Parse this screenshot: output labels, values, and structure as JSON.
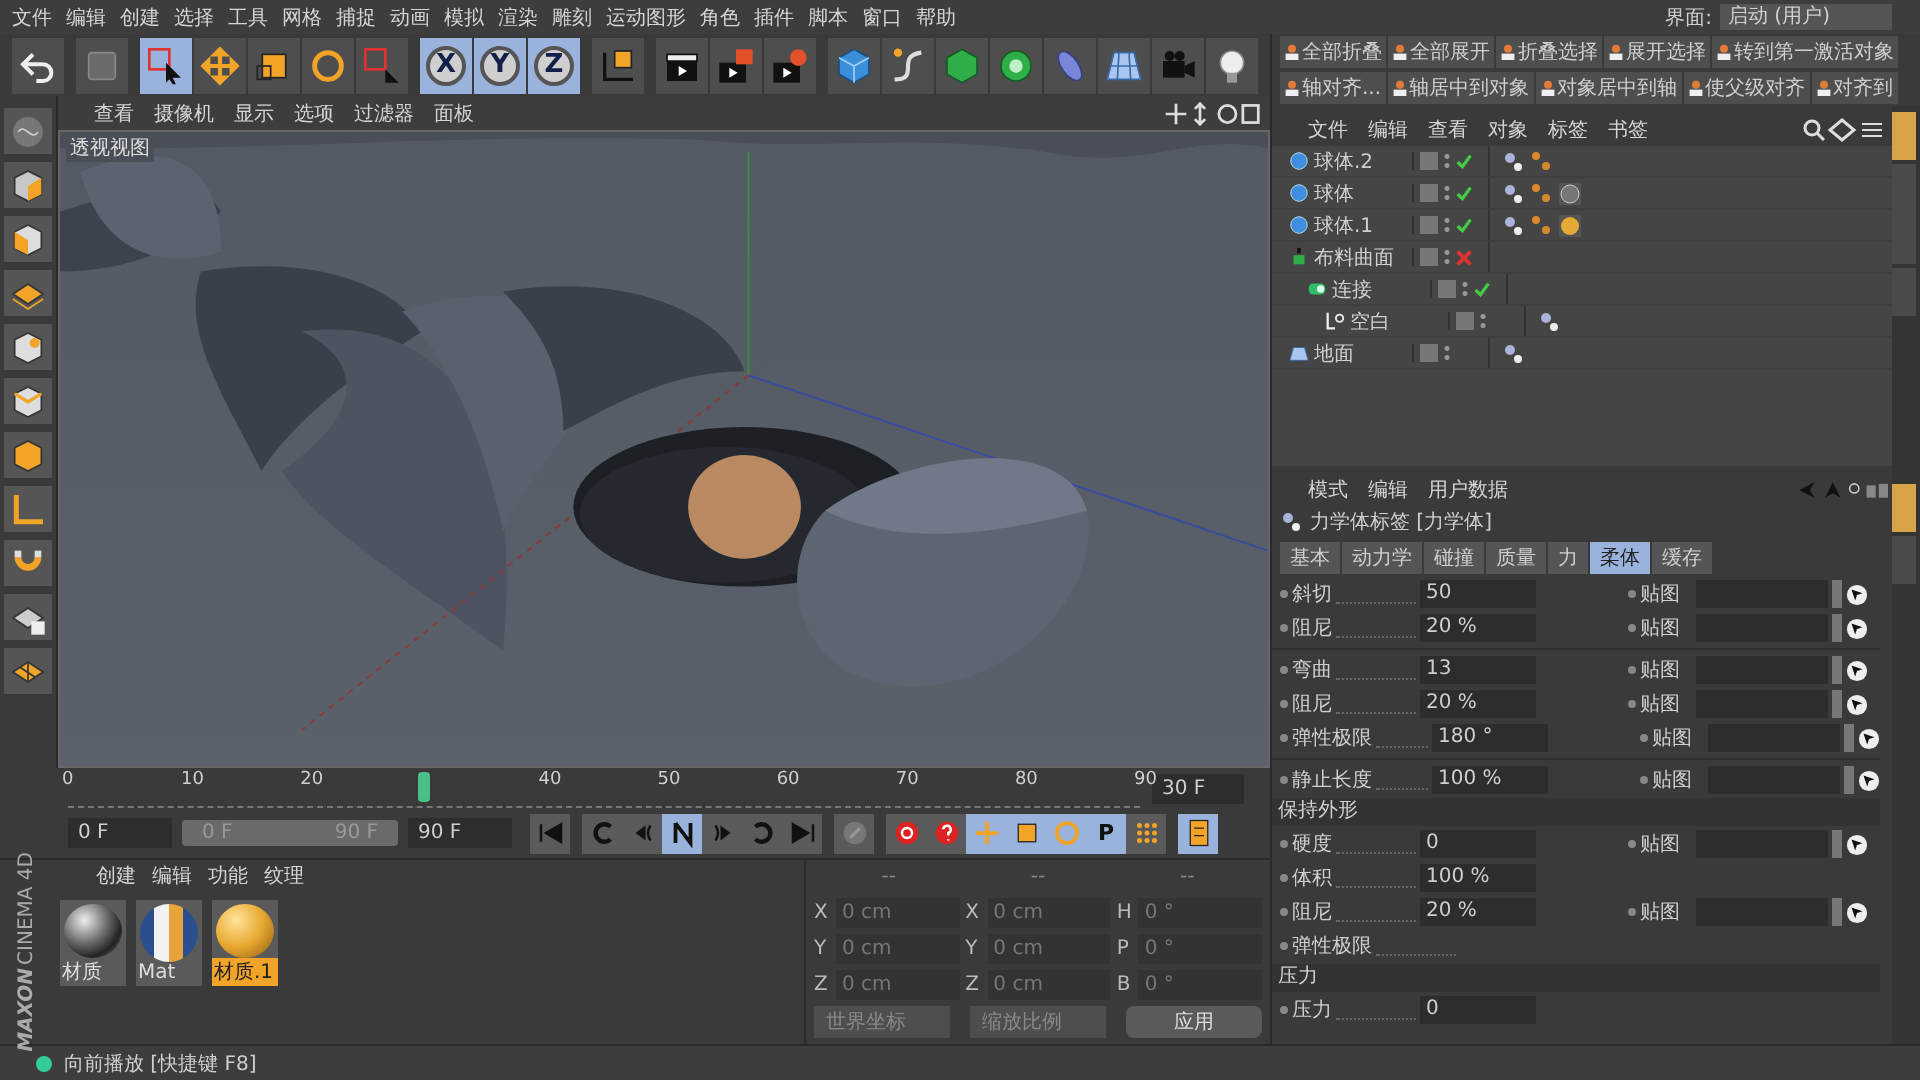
{
  "menu": [
    "文件",
    "编辑",
    "创建",
    "选择",
    "工具",
    "网格",
    "捕捉",
    "动画",
    "模拟",
    "渲染",
    "雕刻",
    "运动图形",
    "角色",
    "插件",
    "脚本",
    "窗口",
    "帮助"
  ],
  "layout": {
    "label": "界面:",
    "value": "启动 (用户)"
  },
  "toolbar": [
    {
      "kind": "icon",
      "selected": false
    },
    {
      "kind": "icon",
      "selected": false
    },
    {
      "kind": "icon",
      "selected": true
    },
    {
      "kind": "icon",
      "selected": false
    },
    {
      "kind": "icon",
      "selected": false
    },
    {
      "kind": "icon",
      "selected": false
    },
    {
      "kind": "icon",
      "selected": false
    },
    {
      "kind": "axis",
      "label": "X",
      "selected": true
    },
    {
      "kind": "axis",
      "label": "Y",
      "selected": true
    },
    {
      "kind": "axis",
      "label": "Z",
      "selected": true
    },
    {
      "kind": "icon",
      "selected": false
    },
    {
      "kind": "icon",
      "selected": false
    },
    {
      "kind": "icon",
      "selected": false
    },
    {
      "kind": "icon",
      "selected": false
    },
    {
      "kind": "icon",
      "selected": false
    },
    {
      "kind": "icon",
      "selected": false
    },
    {
      "kind": "icon",
      "selected": false
    },
    {
      "kind": "icon",
      "selected": false
    },
    {
      "kind": "icon",
      "selected": false
    },
    {
      "kind": "icon",
      "selected": false
    },
    {
      "kind": "icon",
      "selected": false
    },
    {
      "kind": "icon",
      "selected": false
    }
  ],
  "viewport": {
    "menu": [
      "查看",
      "摄像机",
      "显示",
      "选项",
      "过滤器",
      "面板"
    ],
    "label": "透视视图"
  },
  "timeline": {
    "ticks": [
      "0",
      "10",
      "20",
      "40",
      "50",
      "60",
      "70",
      "80",
      "90"
    ],
    "level": 0.333,
    "current": "30 F"
  },
  "transport": {
    "start": "0 F",
    "range": {
      "start": "0 F",
      "end": "90 F",
      "level": 1
    },
    "end": "90 F",
    "buttons": [
      {
        "kind": "icon",
        "selected": false
      },
      {
        "kind": "icon",
        "selected": false
      },
      {
        "kind": "icon",
        "selected": false
      },
      {
        "kind": "icon",
        "selected": true
      },
      {
        "kind": "icon",
        "selected": false
      },
      {
        "kind": "icon",
        "selected": false
      },
      {
        "kind": "icon",
        "selected": false
      },
      {
        "kind": "icon",
        "selected": false
      },
      {
        "kind": "icon",
        "selected": false
      },
      {
        "kind": "icon",
        "selected": false
      },
      {
        "kind": "icon",
        "selected": true
      },
      {
        "kind": "icon",
        "selected": true
      },
      {
        "kind": "icon",
        "selected": true
      },
      {
        "kind": "letter",
        "label": "P",
        "selected": true
      },
      {
        "kind": "icon",
        "selected": false
      },
      {
        "kind": "icon",
        "selected": true
      }
    ]
  },
  "materials": {
    "menu": [
      "创建",
      "编辑",
      "功能",
      "纹理"
    ],
    "items": [
      {
        "name": "材质",
        "kind": "chrome",
        "selected": false
      },
      {
        "name": "Mat",
        "kind": "striped",
        "selected": false
      },
      {
        "name": "材质.1",
        "kind": "gold",
        "selected": true
      }
    ]
  },
  "logo": {
    "brand": "MAXON",
    "product": "CINEMA 4D"
  },
  "coordinates": {
    "headers": [
      "--",
      "--",
      "--"
    ],
    "rows": [
      {
        "axes": [
          "X",
          "X",
          "H"
        ],
        "values": [
          "0 cm",
          "0 cm",
          "0 °"
        ]
      },
      {
        "axes": [
          "Y",
          "Y",
          "P"
        ],
        "values": [
          "0 cm",
          "0 cm",
          "0 °"
        ]
      },
      {
        "axes": [
          "Z",
          "Z",
          "B"
        ],
        "values": [
          "0 cm",
          "0 cm",
          "0 °"
        ]
      }
    ],
    "dropdowns": [
      "世界坐标",
      "缩放比例"
    ],
    "apply": "应用"
  },
  "status_bar": "向前播放 [快捷键 F8]",
  "object_toolbar": [
    [
      "全部折叠",
      "全部展开",
      "折叠选择",
      "展开选择",
      "转到第一激活对象"
    ],
    [
      "轴对齐...",
      "轴居中到对象",
      "对象居中到轴",
      "使父级对齐",
      "对齐到"
    ]
  ],
  "object_manager": {
    "menu": [
      "文件",
      "编辑",
      "查看",
      "对象",
      "标签",
      "书签"
    ],
    "objects": [
      {
        "name": "球体.2",
        "kind": "sphere",
        "enabled": true,
        "tags": [
          {
            "kind": "dynamics"
          },
          {
            "kind": "dots"
          }
        ]
      },
      {
        "name": "球体",
        "kind": "sphere",
        "enabled": true,
        "tags": [
          {
            "kind": "dynamics"
          },
          {
            "kind": "dots"
          },
          {
            "kind": "chrome"
          }
        ]
      },
      {
        "name": "球体.1",
        "kind": "sphere",
        "enabled": true,
        "tags": [
          {
            "kind": "dynamics"
          },
          {
            "kind": "dots"
          },
          {
            "kind": "gold"
          }
        ]
      },
      {
        "name": "布料曲面",
        "kind": "cloth",
        "enabled": false,
        "children": [
          {
            "name": "连接",
            "kind": "connect",
            "enabled": true,
            "children": [
              {
                "name": "空白",
                "kind": "null",
                "tags": [
                  {
                    "kind": "dynamics"
                  }
                ]
              }
            ]
          }
        ]
      },
      {
        "name": "地面",
        "kind": "floor",
        "tags": [
          {
            "kind": "dynamics"
          }
        ]
      }
    ]
  },
  "attributes": {
    "menu": [
      "模式",
      "编辑",
      "用户数据"
    ],
    "title": "力学体标签 [力学体]",
    "tabs": [
      {
        "label": "基本",
        "selected": false
      },
      {
        "label": "动力学",
        "selected": false
      },
      {
        "label": "碰撞",
        "selected": false
      },
      {
        "label": "质量",
        "selected": false
      },
      {
        "label": "力",
        "selected": false
      },
      {
        "label": "柔体",
        "selected": true
      },
      {
        "label": "缓存",
        "selected": false
      }
    ],
    "sections": [
      {
        "rows": [
          {
            "label": "斜切",
            "value": "50",
            "map": "贴图"
          },
          {
            "label": "阻尼",
            "value": "20 %",
            "map": "贴图"
          }
        ]
      },
      {
        "rows": [
          {
            "label": "弯曲",
            "value": "13",
            "map": "贴图"
          },
          {
            "label": "阻尼",
            "value": "20 %",
            "map": "贴图"
          },
          {
            "label": "弹性极限",
            "value": "180 °",
            "map": "贴图"
          }
        ]
      },
      {
        "rows": [
          {
            "label": "静止长度",
            "value": "100 %",
            "map": "贴图"
          }
        ]
      },
      {
        "title": "保持外形",
        "rows": [
          {
            "label": "硬度",
            "value": "0",
            "map": "贴图"
          },
          {
            "label": "体积",
            "value": "100 %"
          },
          {
            "label": "阻尼",
            "value": "20 %",
            "map": "贴图"
          },
          {
            "label": "弹性极限"
          }
        ]
      },
      {
        "title": "压力",
        "rows": [
          {
            "label": "压力",
            "value": "0"
          }
        ]
      }
    ]
  }
}
